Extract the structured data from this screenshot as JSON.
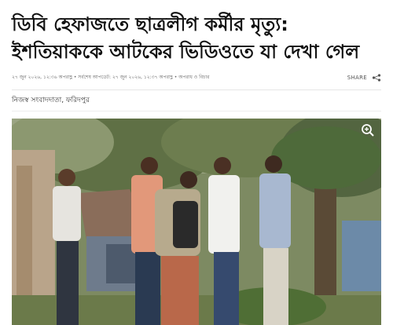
{
  "article": {
    "headline_line1": "ডিবি হেফাজতে ছাত্রলীগ কর্মীর মৃত্যু:",
    "headline_line2": "ইশতিয়াককে আটকের ভিডিওতে যা দেখা গেল",
    "dateline": "২৭ জুন ২০২৬, ১২:৩৬ অপরাহ্ণ • সর্বশেষ আপডেট: ২৭ জুন ২০২৬, ১২:৩৭ অপরাহ্ণ • অপরাধ ও বিচার",
    "share_label": "SHARE",
    "byline": "নিজস্ব সংবাদদাতা, ফরিদপুর"
  },
  "icons": {
    "share": "share-icon",
    "zoom": "zoom-in-icon"
  },
  "colors": {
    "text": "#111111",
    "meta": "#666666",
    "divider": "#e6e6e6"
  }
}
